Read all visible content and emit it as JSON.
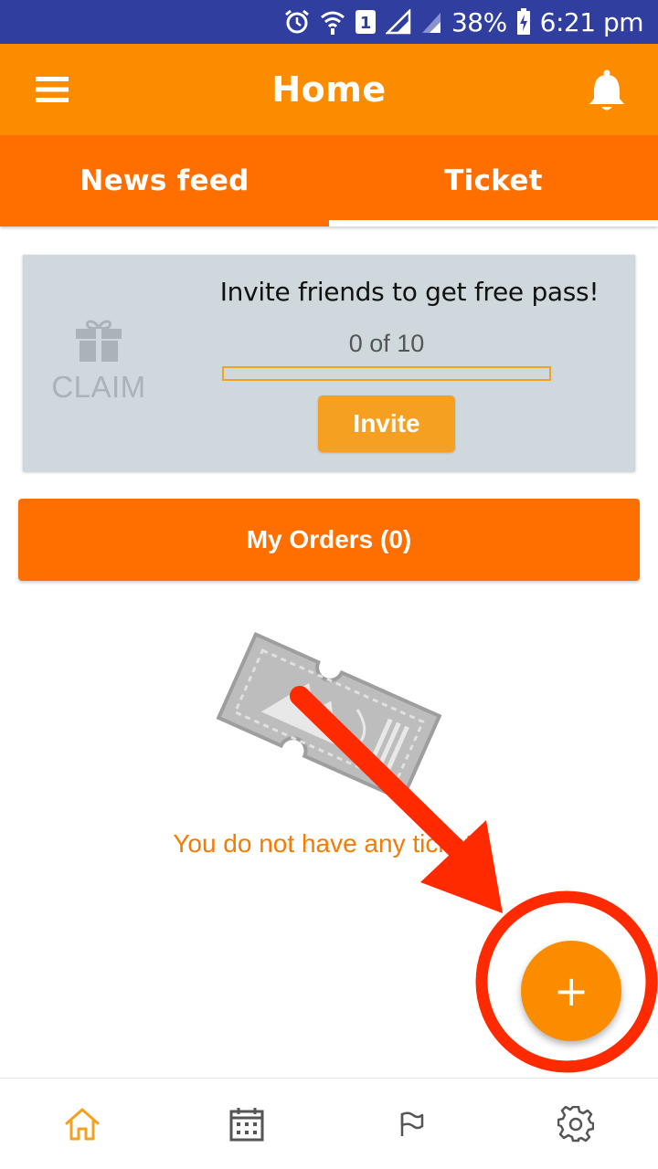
{
  "status_bar": {
    "battery": "38%",
    "time": "6:21 pm",
    "sim_slot": "1"
  },
  "app_bar": {
    "title": "Home"
  },
  "tabs": [
    {
      "label": "News feed",
      "selected": false
    },
    {
      "label": "Ticket",
      "selected": true
    }
  ],
  "invite_card": {
    "claim_label": "CLAIM",
    "headline": "Invite friends to get free pass!",
    "progress_text": "0 of 10",
    "progress": 0,
    "button_label": "Invite"
  },
  "orders_button": {
    "label": "My Orders (0)"
  },
  "empty_state": {
    "message": "You do not have any tickets"
  },
  "fab": {
    "label": "+"
  },
  "bottom_nav": [
    {
      "icon": "home-icon",
      "active": true
    },
    {
      "icon": "calendar-icon",
      "active": false
    },
    {
      "icon": "flag-icon",
      "active": false
    },
    {
      "icon": "gear-icon",
      "active": false
    }
  ],
  "colors": {
    "status_bar": "#303f9f",
    "app_bar": "#fb8c00",
    "tabs": "#ff6f00",
    "accent": "#f5a020",
    "card_bg": "#cfd8dc",
    "annotation": "#ff2a00"
  }
}
